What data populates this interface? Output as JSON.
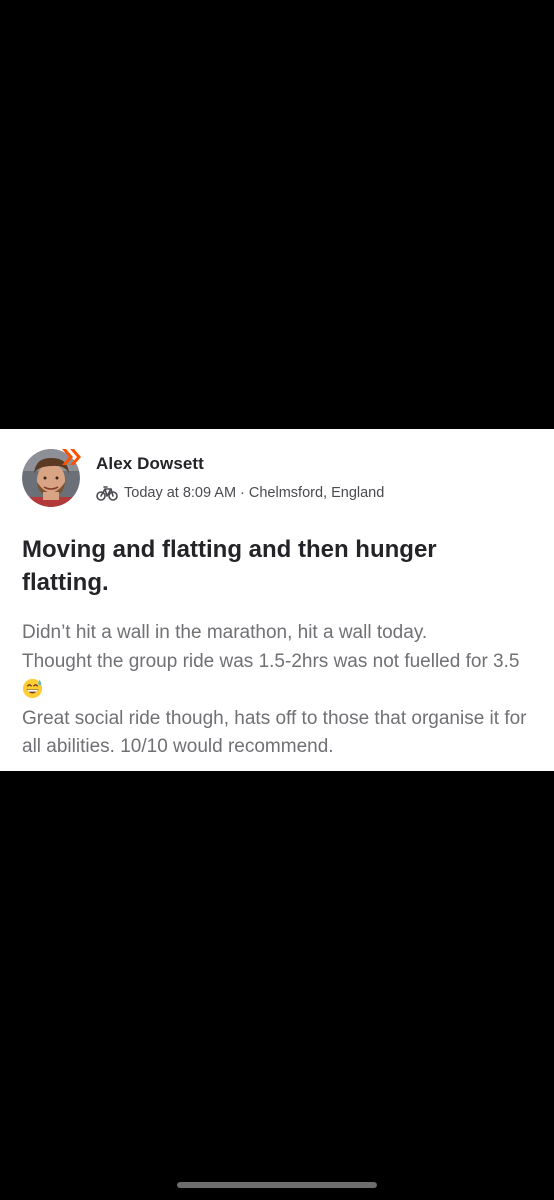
{
  "activity": {
    "author_name": "Alex Dowsett",
    "timestamp": "Today at 8:09 AM",
    "separator": "·",
    "location": "Chelmsford, England",
    "activity_type_icon": "bike-icon",
    "title": "Moving and flatting and then hunger flatting.",
    "description_lines": [
      "Didn’t hit a wall in the marathon, hit a wall today.",
      "Thought the group ride was 1.5-2hrs was not fuelled for 3.5",
      "Great social ride though, hats off to those that organise it for all abilities. 10/10 would recommend."
    ],
    "emoji_icon": "grinning-sweat-emoji-icon"
  },
  "colors": {
    "background": "#000000",
    "card": "#ffffff",
    "title_text": "#242428",
    "body_text": "#707075",
    "accent": "#fc5200"
  }
}
